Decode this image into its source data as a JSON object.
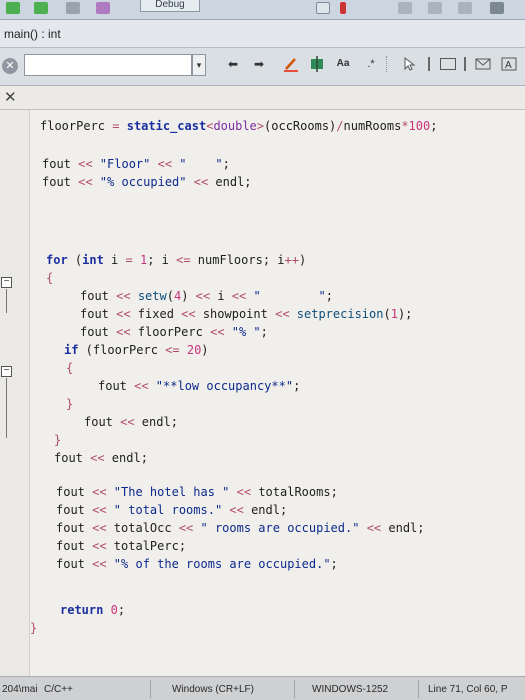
{
  "toolbar": {
    "debug_label": "Debug"
  },
  "function_bar": {
    "label": "main() : int"
  },
  "find_bar": {
    "value": "",
    "dropdown_icon": "chevron-down-icon",
    "regex_label": ".*",
    "case_label": "Aa"
  },
  "editor_tab": {
    "close_symbol": "✕"
  },
  "code_lines": [
    [
      [
        "id",
        "floorPerc "
      ],
      [
        "op",
        "="
      ],
      [
        "id",
        " "
      ],
      [
        "kw",
        "static_cast"
      ],
      [
        "op",
        "<"
      ],
      [
        "tpl",
        "double"
      ],
      [
        "op",
        ">"
      ],
      [
        "id",
        "(occRooms)"
      ],
      [
        "op",
        "/"
      ],
      [
        "id",
        "numRooms"
      ],
      [
        "op",
        "*"
      ],
      [
        "num",
        "100"
      ],
      [
        "id",
        ";"
      ]
    ],
    [
      [
        "id",
        "fout "
      ],
      [
        "op",
        "<<"
      ],
      [
        "str",
        " \"Floor\""
      ],
      [
        "id",
        " "
      ],
      [
        "op",
        "<<"
      ],
      [
        "str",
        " \"    \""
      ],
      [
        "id",
        ";"
      ]
    ],
    [
      [
        "id",
        "fout "
      ],
      [
        "op",
        "<<"
      ],
      [
        "str",
        " \"% occupied\""
      ],
      [
        "id",
        " "
      ],
      [
        "op",
        "<<"
      ],
      [
        "id",
        " endl;"
      ]
    ],
    [
      [
        "kw",
        "for"
      ],
      [
        "id",
        " ("
      ],
      [
        "kw",
        "int"
      ],
      [
        "id",
        " i "
      ],
      [
        "op",
        "="
      ],
      [
        "id",
        " "
      ],
      [
        "num",
        "1"
      ],
      [
        "id",
        "; i "
      ],
      [
        "op",
        "<="
      ],
      [
        "id",
        " numFloors; i"
      ],
      [
        "op",
        "++"
      ],
      [
        "id",
        ")"
      ]
    ],
    [
      [
        "op",
        "{"
      ]
    ],
    [
      [
        "id",
        "fout "
      ],
      [
        "op",
        "<<"
      ],
      [
        "id",
        " "
      ],
      [
        "fn",
        "setw"
      ],
      [
        "id",
        "("
      ],
      [
        "num",
        "4"
      ],
      [
        "id",
        ") "
      ],
      [
        "op",
        "<<"
      ],
      [
        "id",
        " i "
      ],
      [
        "op",
        "<<"
      ],
      [
        "str",
        " \"        \""
      ],
      [
        "id",
        ";"
      ]
    ],
    [
      [
        "id",
        "fout "
      ],
      [
        "op",
        "<<"
      ],
      [
        "id",
        " fixed "
      ],
      [
        "op",
        "<<"
      ],
      [
        "id",
        " showpoint "
      ],
      [
        "op",
        "<<"
      ],
      [
        "id",
        " "
      ],
      [
        "fn",
        "setprecision"
      ],
      [
        "id",
        "("
      ],
      [
        "num",
        "1"
      ],
      [
        "id",
        ");"
      ]
    ],
    [
      [
        "id",
        "fout "
      ],
      [
        "op",
        "<<"
      ],
      [
        "id",
        " floorPerc "
      ],
      [
        "op",
        "<<"
      ],
      [
        "str",
        " \"% \""
      ],
      [
        "id",
        ";"
      ]
    ],
    [
      [
        "kw",
        "if"
      ],
      [
        "id",
        " (floorPerc "
      ],
      [
        "op",
        "<="
      ],
      [
        "id",
        " "
      ],
      [
        "num",
        "20"
      ],
      [
        "id",
        ")"
      ]
    ],
    [
      [
        "op",
        "{"
      ]
    ],
    [
      [
        "id",
        "fout "
      ],
      [
        "op",
        "<<"
      ],
      [
        "str",
        " \"**low occupancy**\""
      ],
      [
        "id",
        ";"
      ]
    ],
    [
      [
        "op",
        "}"
      ]
    ],
    [
      [
        "id",
        "fout "
      ],
      [
        "op",
        "<<"
      ],
      [
        "id",
        " endl;"
      ]
    ],
    [
      [
        "op",
        "}"
      ]
    ],
    [
      [
        "id",
        "fout "
      ],
      [
        "op",
        "<<"
      ],
      [
        "id",
        " endl;"
      ]
    ],
    [
      [
        "id",
        "fout "
      ],
      [
        "op",
        "<<"
      ],
      [
        "str",
        " \"The hotel has \""
      ],
      [
        "id",
        " "
      ],
      [
        "op",
        "<<"
      ],
      [
        "id",
        " totalRooms;"
      ]
    ],
    [
      [
        "id",
        "fout "
      ],
      [
        "op",
        "<<"
      ],
      [
        "str",
        " \" total rooms.\""
      ],
      [
        "id",
        " "
      ],
      [
        "op",
        "<<"
      ],
      [
        "id",
        " endl;"
      ]
    ],
    [
      [
        "id",
        "fout "
      ],
      [
        "op",
        "<<"
      ],
      [
        "id",
        " totalOcc "
      ],
      [
        "op",
        "<<"
      ],
      [
        "str",
        " \" rooms are occupied.\""
      ],
      [
        "id",
        " "
      ],
      [
        "op",
        "<<"
      ],
      [
        "id",
        " endl;"
      ]
    ],
    [
      [
        "id",
        "fout "
      ],
      [
        "op",
        "<<"
      ],
      [
        "id",
        " totalPerc;"
      ]
    ],
    [
      [
        "id",
        "fout "
      ],
      [
        "op",
        "<<"
      ],
      [
        "str",
        " \"% of the rooms are occupied.\""
      ],
      [
        "id",
        ";"
      ]
    ],
    [
      [
        "kw",
        "return"
      ],
      [
        "id",
        " "
      ],
      [
        "num",
        "0"
      ],
      [
        "id",
        ";"
      ]
    ],
    [
      [
        "op",
        "}"
      ]
    ]
  ],
  "status_bar": {
    "position": "204\\mai",
    "language": "C/C++",
    "line_endings": "Windows (CR+LF)",
    "encoding": "WINDOWS-1252",
    "cursor": "Line 71, Col 60, P"
  }
}
